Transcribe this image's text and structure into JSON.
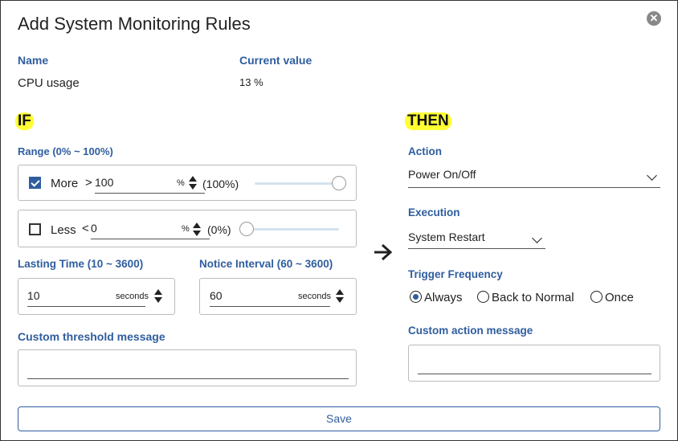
{
  "dialog": {
    "title": "Add System Monitoring Rules",
    "close_icon": "close-icon"
  },
  "info": {
    "name_label": "Name",
    "current_value_label": "Current value",
    "name_value": "CPU usage",
    "current_value": "13 %"
  },
  "if_section": {
    "heading": "IF",
    "range_label": "Range (0% ~ 100%)",
    "more": {
      "checked": true,
      "label": "More",
      "operator": ">",
      "value": "100",
      "unit": "%",
      "percent_display": "(100%)",
      "slider_fraction": 1.0
    },
    "less": {
      "checked": false,
      "label": "Less",
      "operator": "<",
      "value": "0",
      "unit": "%",
      "percent_display": "(0%)",
      "slider_fraction": 0.0
    },
    "lasting_time_label": "Lasting Time (10 ~ 3600)",
    "lasting_time_value": "10",
    "lasting_time_unit": "seconds",
    "notice_interval_label": "Notice Interval (60 ~ 3600)",
    "notice_interval_value": "60",
    "notice_interval_unit": "seconds",
    "custom_threshold_label": "Custom threshold message",
    "custom_threshold_value": ""
  },
  "then_section": {
    "heading": "THEN",
    "action_label": "Action",
    "action_value": "Power On/Off",
    "execution_label": "Execution",
    "execution_value": "System Restart",
    "trigger_label": "Trigger Frequency",
    "trigger_options": [
      "Always",
      "Back to Normal",
      "Once"
    ],
    "trigger_selected": "Always",
    "custom_action_label": "Custom action message",
    "custom_action_value": ""
  },
  "footer": {
    "save_label": "Save"
  },
  "colors": {
    "accent": "#2f5d9e",
    "highlight": "#ffff33",
    "slider_track": "#d4e3ef"
  }
}
